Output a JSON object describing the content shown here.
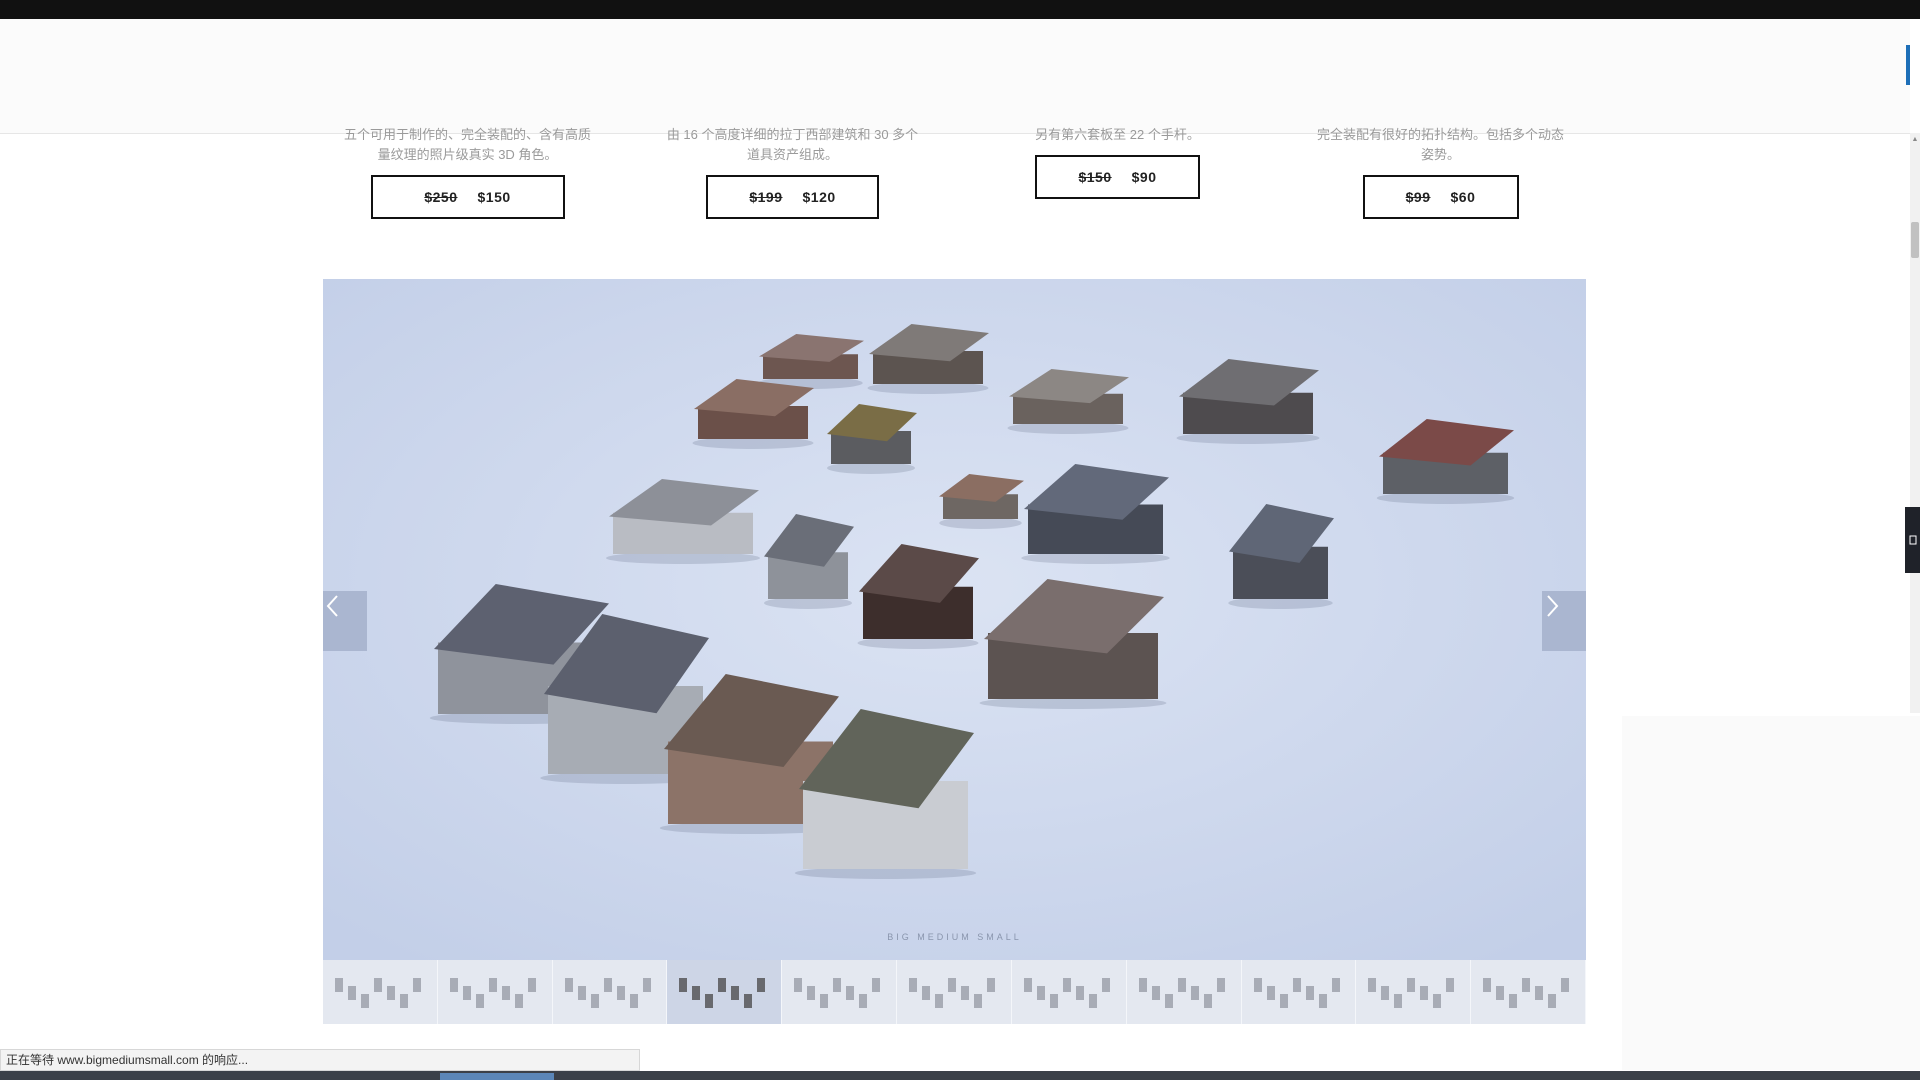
{
  "products": [
    {
      "desc_line1": "五个可用于制作的、完全装配的、含有高质",
      "desc_line2": "量纹理的照片级真实 3D 角色。",
      "old_price": "$250",
      "new_price": "$150"
    },
    {
      "desc_line1": "由 16 个高度详细的拉丁西部建筑和 30 多个",
      "desc_line2": "道具资产组成。",
      "old_price": "$199",
      "new_price": "$120"
    },
    {
      "desc_line1": "另有第六套板至 22 个手杆。",
      "desc_line2": "",
      "old_price": "$150",
      "new_price": "$90"
    },
    {
      "desc_line1": "完全装配有很好的拓扑结构。包括多个动态",
      "desc_line2": "姿势。",
      "old_price": "$99",
      "new_price": "$60"
    }
  ],
  "gallery": {
    "caption": "BIG MEDIUM SMALL",
    "prev_icon": "chevron-left-icon",
    "next_icon": "chevron-right-icon",
    "thumbnail_count": 11,
    "active_thumbnail": 4
  },
  "status_bar": {
    "text": "正在等待 www.bigmediumsmall.com 的响应..."
  },
  "colors": {
    "gallery_bg": "#cfd9ee",
    "price_border": "#111111",
    "top_bar": "#111111"
  }
}
